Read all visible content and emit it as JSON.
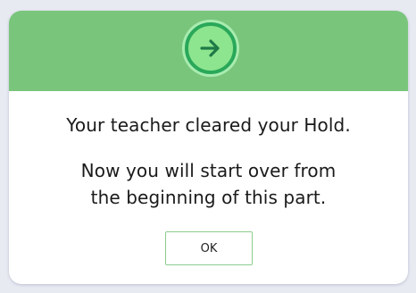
{
  "dialog": {
    "icon": "arrow-right-icon",
    "message_primary": "Your teacher cleared your Hold.",
    "message_secondary_line1": "Now you will start over from",
    "message_secondary_line2": "the beginning of this part.",
    "ok_label": "OK"
  },
  "colors": {
    "header": "#7ac57c",
    "icon_fill": "#8ee58f",
    "icon_ring": "#2aa85a",
    "arrow": "#1e7a46",
    "button_border": "#8dcc8e"
  }
}
